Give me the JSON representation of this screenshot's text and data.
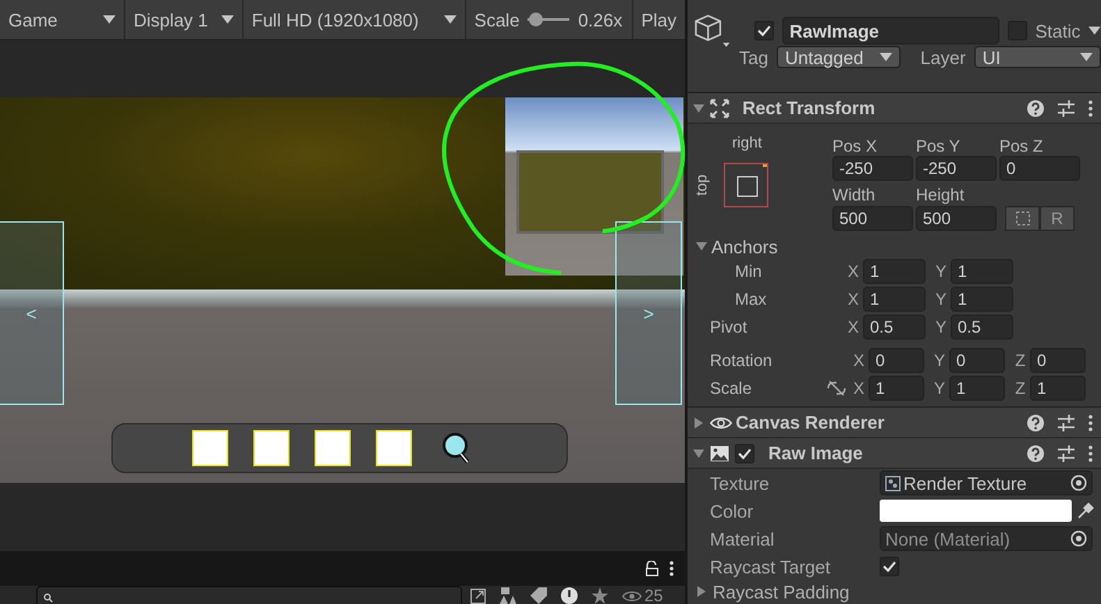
{
  "toolbar": {
    "view": "Game",
    "display": "Display 1",
    "resolution": "Full HD (1920x1080)",
    "scale": {
      "label": "Scale",
      "level": 0.05,
      "reading": "0.26x"
    },
    "play": "Play"
  },
  "game_view": {
    "nav_left": "<",
    "nav_right": ">",
    "inventory_slots": [
      {
        "filled": false
      },
      {
        "filled": false
      },
      {
        "filled": false
      },
      {
        "filled": false
      }
    ]
  },
  "footer": {
    "counter": "25"
  },
  "inspector": {
    "object": {
      "active": true,
      "name": "RawImage",
      "static": false,
      "static_label": "Static",
      "tag_label": "Tag",
      "tag": "Untagged",
      "layer_label": "Layer",
      "layer": "UI"
    },
    "rect_transform": {
      "title": "Rect Transform",
      "expanded": true,
      "anchor_h": "right",
      "anchor_v": "top",
      "position": [
        {
          "label": "Pos X",
          "value": "-250"
        },
        {
          "label": "Pos Y",
          "value": "-250"
        },
        {
          "label": "Pos Z",
          "value": "0"
        }
      ],
      "size": [
        {
          "label": "Width",
          "value": "500"
        },
        {
          "label": "Height",
          "value": "500"
        }
      ],
      "raw_button": "R",
      "anchors": {
        "label": "Anchors",
        "expanded": true,
        "rows": [
          {
            "label": "Min",
            "fields": [
              {
                "axis": "X",
                "value": "1"
              },
              {
                "axis": "Y",
                "value": "1"
              }
            ]
          },
          {
            "label": "Max",
            "fields": [
              {
                "axis": "X",
                "value": "1"
              },
              {
                "axis": "Y",
                "value": "1"
              }
            ]
          }
        ]
      },
      "pivot": {
        "label": "Pivot",
        "fields": [
          {
            "axis": "X",
            "value": "0.5"
          },
          {
            "axis": "Y",
            "value": "0.5"
          }
        ]
      },
      "rotation": {
        "label": "Rotation",
        "fields": [
          {
            "axis": "X",
            "value": "0"
          },
          {
            "axis": "Y",
            "value": "0"
          },
          {
            "axis": "Z",
            "value": "0"
          }
        ]
      },
      "scale": {
        "label": "Scale",
        "constrained": false,
        "fields": [
          {
            "axis": "X",
            "value": "1"
          },
          {
            "axis": "Y",
            "value": "1"
          },
          {
            "axis": "Z",
            "value": "1"
          }
        ]
      }
    },
    "canvas_renderer": {
      "title": "Canvas Renderer",
      "expanded": false
    },
    "raw_image": {
      "title": "Raw Image",
      "expanded": true,
      "enabled": true,
      "properties": [
        {
          "kind": "object",
          "label": "Texture",
          "value": "Render Texture",
          "icon": true
        },
        {
          "kind": "color",
          "label": "Color",
          "color": "#ffffff"
        },
        {
          "kind": "object",
          "label": "Material",
          "value": "None (Material)",
          "icon": false
        },
        {
          "kind": "checkbox",
          "label": "Raycast Target",
          "checked": true
        },
        {
          "kind": "foldout",
          "label": "Raycast Padding",
          "expanded": false
        }
      ]
    }
  }
}
